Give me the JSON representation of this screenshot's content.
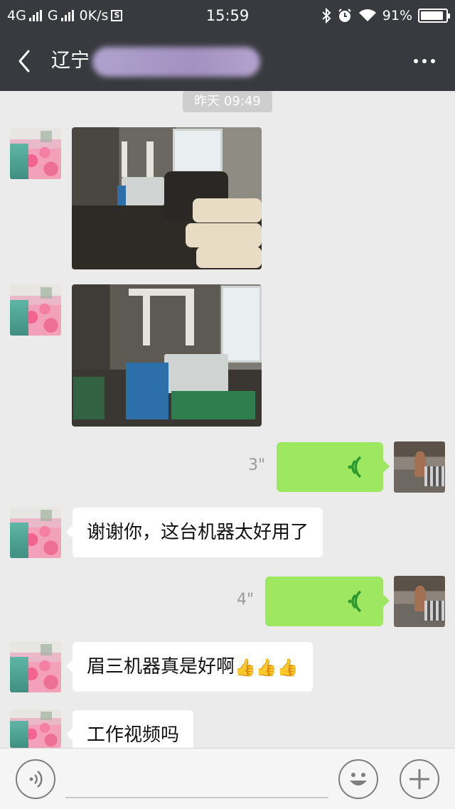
{
  "status_bar": {
    "network": "4G",
    "network2": "G",
    "speed": "0K/s",
    "s_badge": "S",
    "time": "15:59",
    "battery": "91%",
    "battery_level": 0.91,
    "icons": [
      "signal-icon",
      "bluetooth-icon",
      "alarm-icon",
      "wifi-icon",
      "battery-icon"
    ]
  },
  "header": {
    "title_visible": "辽宁",
    "icons": [
      "back-arrow-icon",
      "more-icon"
    ]
  },
  "chat": {
    "timestamp": "昨天 09:49",
    "messages": [
      {
        "side": "left",
        "type": "image",
        "avatar": "avatar-bed"
      },
      {
        "side": "left",
        "type": "image",
        "avatar": "avatar-bed"
      },
      {
        "side": "right",
        "type": "voice",
        "duration": "3\"",
        "avatar": "avatar-man"
      },
      {
        "side": "left",
        "type": "text",
        "text": "谢谢你，这台机器太好用了",
        "avatar": "avatar-bed"
      },
      {
        "side": "right",
        "type": "voice",
        "duration": "4\"",
        "avatar": "avatar-man"
      },
      {
        "side": "left",
        "type": "text",
        "text": "眉三机器真是好啊",
        "emoji": "👍👍👍",
        "avatar": "avatar-bed"
      },
      {
        "side": "left",
        "type": "text",
        "text": "工作视频吗",
        "avatar": "avatar-bed"
      }
    ]
  },
  "input_bar": {
    "value": "",
    "icons": [
      "voice-toggle-icon",
      "emoji-icon",
      "plus-icon"
    ]
  },
  "colors": {
    "header_bg": "#393a3f",
    "chat_bg": "#ebebeb",
    "voice_bubble": "#9ee861",
    "voice_icon": "#2c9a2f"
  }
}
